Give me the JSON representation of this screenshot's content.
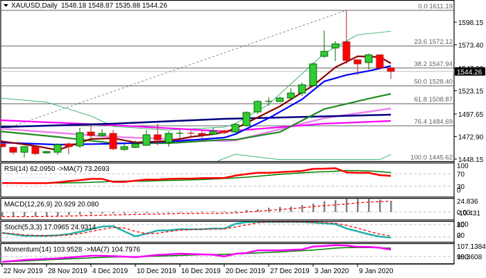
{
  "header": {
    "symbol_label": "XAUUSD,Daily",
    "ohlc_label": "1548.18 1548.87 1535.88 1544.26",
    "menu_icon": "triangle-down-icon"
  },
  "colors": {
    "bull": "#32CD32",
    "bull_border": "#006400",
    "bear": "#FF0000",
    "bear_border": "#B22222",
    "ma_fast": "#8B0000",
    "ma_blue": "#0000FF",
    "ma_green": "#228B22",
    "ma_navy": "#000080",
    "ma_magenta": "#FF00FF",
    "ma_violet": "#EE82EE",
    "band": "#3CB371",
    "fib": "#606060",
    "trend": "#778899",
    "rsi": "#FF0000",
    "rsi_ma": "#008000",
    "macd_hist": "#808080",
    "macd_signal": "#FF0000",
    "stoch_main": "#20B2AA",
    "stoch_signal": "#FF0000",
    "mom": "#FF00FF",
    "mom_ma": "#008000"
  },
  "chart_data": [
    {
      "type": "candlestick",
      "title": "XAUUSD,Daily",
      "ylim": [
        1445.62,
        1611.19
      ],
      "current_price": "1544.26",
      "y_ticks": [
        "1598.15",
        "1573.40",
        "1547.90",
        "1523.15",
        "1497.65",
        "1472.90",
        "1448.15"
      ],
      "x_labels": [
        {
          "label": "22 Nov 2019",
          "index": 0
        },
        {
          "label": "28 Nov 2019",
          "index": 4
        },
        {
          "label": "4 Dec 2019",
          "index": 8
        },
        {
          "label": "10 Dec 2019",
          "index": 12
        },
        {
          "label": "16 Dec 2019",
          "index": 16
        },
        {
          "label": "20 Dec 2019",
          "index": 20
        },
        {
          "label": "27 Dec 2019",
          "index": 24
        },
        {
          "label": "3 Jan 2020",
          "index": 28
        },
        {
          "label": "9 Jan 2020",
          "index": 32
        }
      ],
      "candles_ohlc": [
        [
          1464.9,
          1466.4,
          1461.0,
          1461.8
        ],
        [
          1461.0,
          1461.8,
          1453.4,
          1455.7
        ],
        [
          1455.7,
          1462.6,
          1449.6,
          1461.8
        ],
        [
          1461.8,
          1462.6,
          1452.7,
          1454.2
        ],
        [
          1455.0,
          1457.3,
          1454.2,
          1456.5
        ],
        [
          1455.7,
          1465.6,
          1452.7,
          1464.1
        ],
        [
          1464.9,
          1466.4,
          1453.4,
          1461.8
        ],
        [
          1462.6,
          1482.4,
          1460.3,
          1477.1
        ],
        [
          1477.8,
          1485.4,
          1471.0,
          1474.0
        ],
        [
          1474.0,
          1480.9,
          1472.5,
          1476.3
        ],
        [
          1476.3,
          1480.1,
          1458.0,
          1459.5
        ],
        [
          1458.8,
          1464.9,
          1457.3,
          1461.8
        ],
        [
          1461.0,
          1468.7,
          1460.3,
          1464.9
        ],
        [
          1463.3,
          1480.1,
          1463.3,
          1474.8
        ],
        [
          1474.8,
          1487.0,
          1463.3,
          1469.4
        ],
        [
          1466.4,
          1478.6,
          1461.8,
          1476.3
        ],
        [
          1476.3,
          1480.1,
          1471.0,
          1476.5
        ],
        [
          1476.5,
          1479.3,
          1472.5,
          1476.3
        ],
        [
          1476.3,
          1480.1,
          1471.0,
          1474.8
        ],
        [
          1475.5,
          1482.4,
          1475.5,
          1478.6
        ],
        [
          1479.3,
          1480.1,
          1475.5,
          1477.1
        ],
        [
          1477.8,
          1487.7,
          1477.1,
          1486.2
        ],
        [
          1484.7,
          1500.7,
          1483.9,
          1499.2
        ],
        [
          1499.9,
          1512.8,
          1497.6,
          1511.3
        ],
        [
          1511.3,
          1515.9,
          1506.8,
          1511.5
        ],
        [
          1511.3,
          1516.6,
          1511.3,
          1515.1
        ],
        [
          1515.1,
          1525.8,
          1515.1,
          1520.5
        ],
        [
          1520.5,
          1531.9,
          1517.4,
          1529.6
        ],
        [
          1528.8,
          1554.0,
          1528.8,
          1552.5
        ],
        [
          1560.8,
          1589.0,
          1559.3,
          1566.2
        ],
        [
          1570.0,
          1577.6,
          1555.5,
          1574.5
        ],
        [
          1576.8,
          1611.19,
          1552.5,
          1556.3
        ],
        [
          1557.0,
          1557.0,
          1540.3,
          1552.5
        ],
        [
          1554.0,
          1563.9,
          1546.4,
          1562.4
        ],
        [
          1562.4,
          1563.0,
          1547.9,
          1547.9
        ],
        [
          1548.18,
          1548.87,
          1535.88,
          1544.26
        ]
      ],
      "moving_averages": [
        {
          "name": "ma_fast",
          "points": [
            [
              -0.2,
              1468
            ],
            [
              3,
              1462.6
            ],
            [
              5,
              1458
            ],
            [
              8,
              1470.2
            ],
            [
              10,
              1471
            ],
            [
              12,
              1466.4
            ],
            [
              15,
              1468
            ],
            [
              17,
              1472.5
            ],
            [
              19,
              1475.5
            ],
            [
              20,
              1477.8
            ],
            [
              21,
              1481.6
            ],
            [
              25,
              1506
            ],
            [
              28,
              1528.8
            ],
            [
              30,
              1548.7
            ],
            [
              32,
              1560.8
            ],
            [
              34,
              1560
            ],
            [
              35,
              1553.2
            ]
          ]
        },
        {
          "name": "ma_blue",
          "points": [
            [
              -0.2,
              1466.4
            ],
            [
              5,
              1464
            ],
            [
              10,
              1465
            ],
            [
              15,
              1467.2
            ],
            [
              20,
              1471.7
            ],
            [
              21,
              1475.5
            ],
            [
              24,
              1493
            ],
            [
              27,
              1513.6
            ],
            [
              29,
              1533.4
            ],
            [
              31,
              1540.3
            ],
            [
              33,
              1544.8
            ],
            [
              35,
              1550.2
            ]
          ]
        },
        {
          "name": "ma_green",
          "points": [
            [
              -0.2,
              1478.6
            ],
            [
              5,
              1472.5
            ],
            [
              10,
              1465.6
            ],
            [
              15,
              1465.6
            ],
            [
              20,
              1469.4
            ],
            [
              21,
              1469.4
            ],
            [
              25,
              1477.8
            ],
            [
              29,
              1503
            ],
            [
              33,
              1514.4
            ],
            [
              35,
              1519.7
            ]
          ]
        },
        {
          "name": "ma_navy",
          "points": [
            [
              -0.2,
              1483.2
            ],
            [
              10,
              1487
            ],
            [
              20,
              1492.3
            ],
            [
              23,
              1493.1
            ],
            [
              35,
              1496.9
            ]
          ]
        },
        {
          "name": "ma_magenta",
          "points": [
            [
              -0.2,
              1490.8
            ],
            [
              10,
              1485.4
            ],
            [
              20,
              1478.6
            ],
            [
              21,
              1479.3
            ],
            [
              29,
              1487
            ],
            [
              35,
              1490
            ]
          ]
        },
        {
          "name": "ma_violet",
          "points": [
            [
              -0.2,
              1481.6
            ],
            [
              10,
              1472.5
            ],
            [
              20,
              1468
            ],
            [
              21,
              1468.7
            ],
            [
              29,
              1493
            ],
            [
              35,
              1503.7
            ]
          ]
        },
        {
          "name": "band_upper",
          "points": [
            [
              -0.2,
              1515.1
            ],
            [
              4,
              1510.6
            ],
            [
              8,
              1495.4
            ],
            [
              10,
              1484
            ],
            [
              15,
              1480
            ],
            [
              20,
              1483.2
            ],
            [
              21,
              1487
            ],
            [
              24,
              1508.3
            ],
            [
              29,
              1563.9
            ],
            [
              32,
              1584.4
            ],
            [
              35,
              1588.2
            ]
          ]
        },
        {
          "name": "band_lower",
          "points": [
            [
              19,
              1444
            ],
            [
              20,
              1448.9
            ],
            [
              21,
              1453.4
            ],
            [
              25,
              1447.6
            ],
            [
              34,
              1447.6
            ],
            [
              35,
              1453.4
            ]
          ]
        }
      ],
      "fibonacci": [
        {
          "label": "0.0 1611.19",
          "price": 1611.19
        },
        {
          "label": "23.6 1572.12",
          "price": 1572.12
        },
        {
          "label": "38.2 1547.94",
          "price": 1547.94
        },
        {
          "label": "50.0 1528.40",
          "price": 1528.4
        },
        {
          "label": "61.8 1508.87",
          "price": 1508.87
        },
        {
          "label": "76.4 1484.69",
          "price": 1484.69
        },
        {
          "label": "100.0 1445.62",
          "price": 1445.62
        }
      ],
      "trendline": [
        [
          -0.2,
          1479.3
        ],
        [
          31,
          1611.19
        ]
      ]
    },
    {
      "type": "line",
      "name": "rsi",
      "title": "RSI(14) 62.0950  ->MA(7) 73.2693",
      "ylim": [
        0,
        100
      ],
      "levels": [
        70,
        30
      ],
      "y_ticks": [
        "100",
        "70",
        "30",
        "0"
      ],
      "series": [
        {
          "name": "rsi",
          "values": [
            40.4,
            40.4,
            40,
            40,
            40,
            42.6,
            46.3,
            49.5,
            53.7,
            53.7,
            44.1,
            44.1,
            47.8,
            51.5,
            51,
            53.7,
            54.5,
            54.5,
            56.2,
            56,
            56.7,
            64,
            69,
            73,
            73,
            75,
            77,
            79,
            85.6,
            86,
            87.8,
            74.4,
            73,
            73,
            65.5,
            63
          ]
        },
        {
          "name": "ma",
          "values": [
            40.4,
            40.4,
            40.4,
            40.4,
            40.4,
            40.4,
            41,
            41.5,
            42.6,
            44,
            46,
            46.5,
            46.3,
            46.5,
            47.8,
            48.5,
            49.5,
            50.5,
            51.5,
            53,
            55,
            56.7,
            59,
            62,
            65,
            68,
            70.5,
            73,
            75,
            76.7,
            78,
            80,
            80,
            79,
            77,
            74
          ]
        }
      ]
    },
    {
      "type": "bar+line",
      "name": "macd",
      "title": "MACD(12,26,9) 20.929 20.080",
      "y_ticks": [
        "24.836",
        "0.00",
        "-10.431"
      ],
      "series": [
        {
          "name": "macd",
          "values": [
            -8,
            -9,
            -9,
            -9,
            -8,
            -7,
            -6,
            -5,
            -4,
            -3,
            -3,
            -3,
            -2,
            -2,
            -1,
            -1,
            0,
            0.5,
            1,
            1.5,
            1,
            2,
            4,
            5,
            8,
            9.5,
            10,
            13,
            15.6,
            20,
            22,
            24.5,
            24.5,
            24.5,
            23,
            20.929
          ]
        },
        {
          "name": "signal",
          "values": [
            -8.7,
            -8.7,
            -8.6,
            -8.5,
            -8.3,
            -8,
            -7.6,
            -7.1,
            -6.6,
            -6,
            -5.5,
            -5,
            -4.6,
            -4.2,
            -3.8,
            -3.4,
            -3,
            -2.8,
            -2.6,
            -2.6,
            -2.4,
            -1.5,
            0,
            1.5,
            3,
            4.5,
            6,
            8,
            10,
            12,
            13,
            15,
            17,
            18.5,
            19.5,
            20.08
          ]
        }
      ]
    },
    {
      "type": "line",
      "name": "stochastic",
      "title": "Stoch(5,3,3) 17.0965 24.9314",
      "ylim": [
        0,
        100
      ],
      "levels": [
        80,
        20
      ],
      "y_ticks": [
        "100",
        "80",
        "20",
        "0"
      ],
      "series": [
        {
          "name": "main",
          "values": [
            40,
            33,
            26,
            26,
            26,
            28,
            34,
            45,
            57,
            70,
            72,
            47,
            23,
            36,
            51,
            52,
            57,
            57,
            57,
            61,
            60,
            83,
            91,
            92,
            92,
            92,
            92,
            92,
            89,
            86,
            82,
            61,
            47,
            33,
            22,
            17.0965
          ]
        },
        {
          "name": "signal",
          "values": [
            38,
            36,
            30,
            28,
            26,
            27,
            30,
            36,
            46,
            57,
            66,
            63,
            47,
            36,
            38,
            46,
            53,
            55,
            57,
            58,
            59,
            68,
            78,
            88,
            92,
            92,
            92,
            92,
            91,
            89,
            86,
            76,
            63,
            47,
            34,
            24.9314
          ]
        }
      ]
    },
    {
      "type": "line",
      "name": "momentum",
      "title": "Momentum(14) 103.9528  ->MA(7) 104.7976",
      "levels": [
        100
      ],
      "y_ticks": [
        "107.1384",
        "100",
        "98.3608"
      ],
      "series": [
        {
          "name": "momentum",
          "values": [
            96.9,
            97.4,
            98,
            98.3,
            98.6,
            98.9,
            99.4,
            99.9,
            100.4,
            100.4,
            100.2,
            99.9,
            99.6,
            100.2,
            100.9,
            101.2,
            101.6,
            101.4,
            101.2,
            101,
            100,
            101.5,
            102,
            103.5,
            103.5,
            103.5,
            103.8,
            104,
            105.7,
            106,
            106.5,
            106.3,
            105.5,
            105.5,
            105,
            103.9528
          ]
        },
        {
          "name": "ma",
          "values": [
            96.9,
            97.1,
            97.4,
            97.7,
            98,
            98.3,
            98.6,
            98.9,
            99.2,
            99.5,
            99.7,
            99.8,
            99.9,
            100,
            100.2,
            100.4,
            100.6,
            100.8,
            101,
            101.1,
            101.2,
            101.4,
            101.7,
            102,
            102.3,
            102.6,
            103,
            103.3,
            103.7,
            104.2,
            104.8,
            105.1,
            105.1,
            105.1,
            105,
            104.7976
          ]
        }
      ]
    }
  ]
}
